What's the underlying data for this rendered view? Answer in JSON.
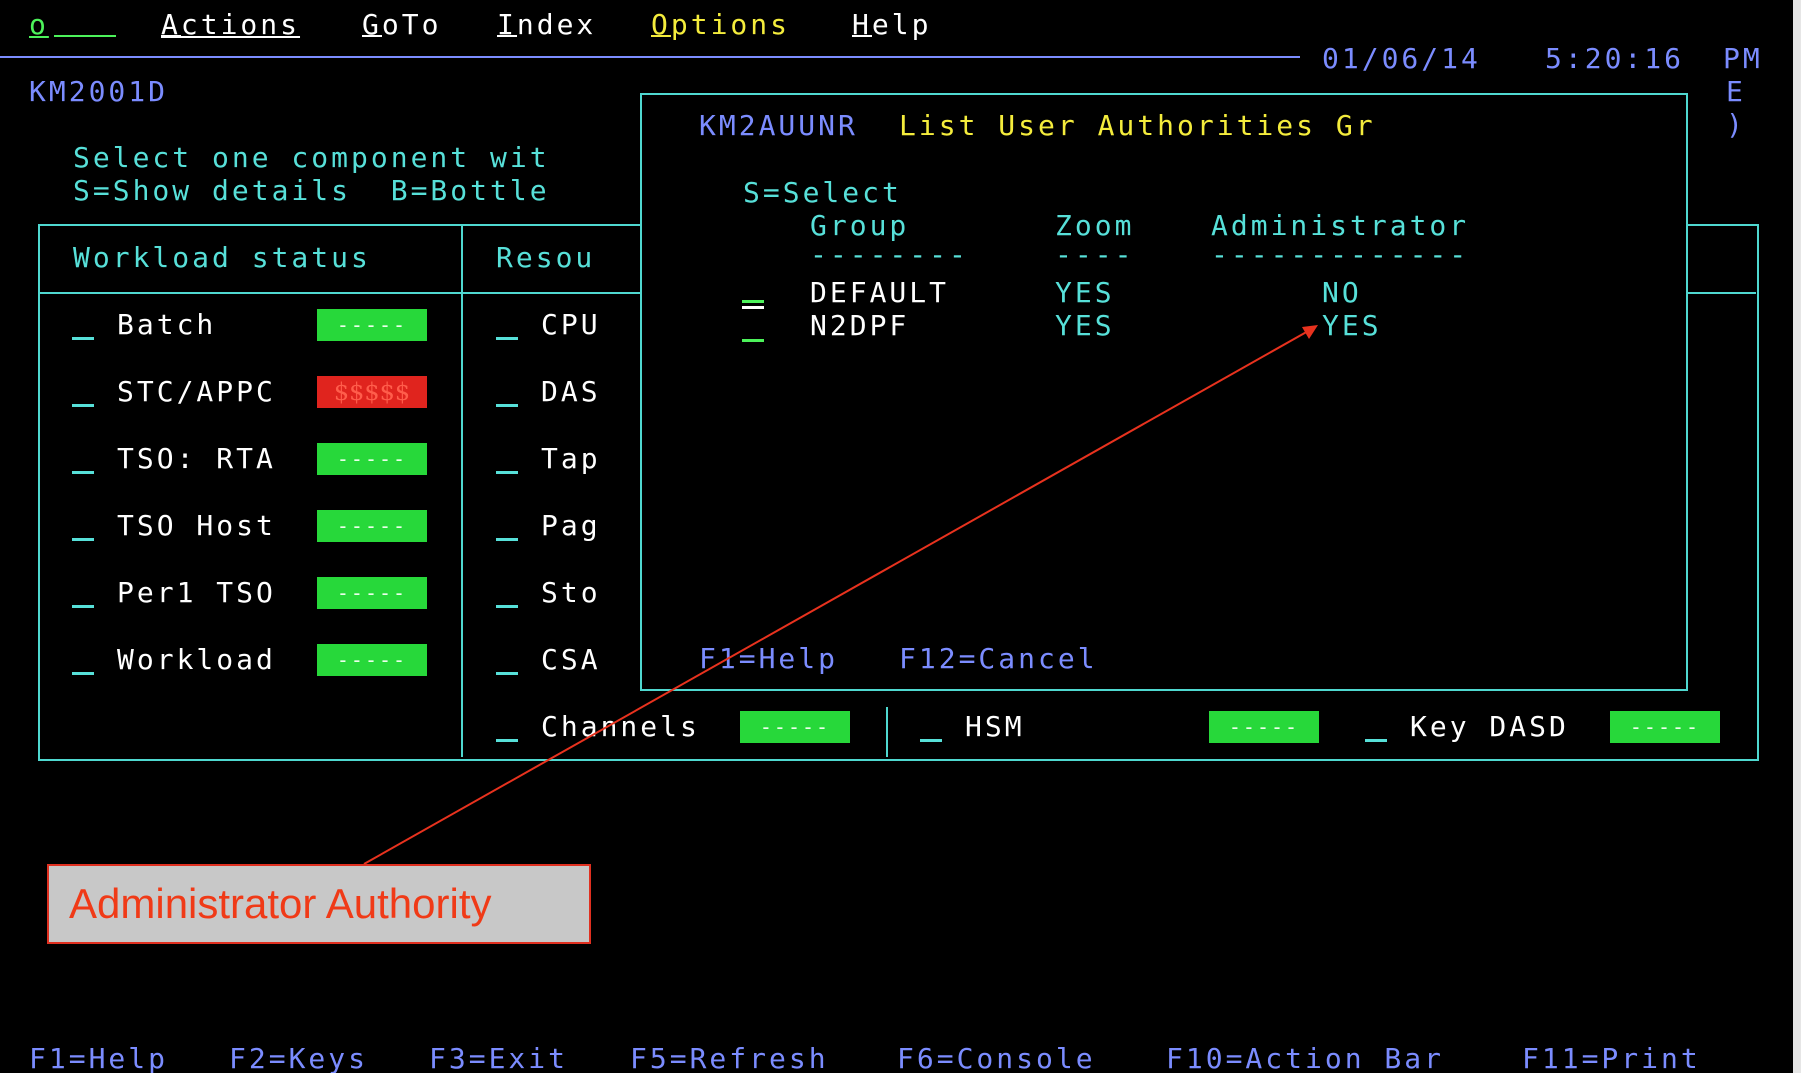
{
  "menu": {
    "input_value": "o",
    "actions": "Actions",
    "goto": "GoTo",
    "index": "Index",
    "options": "Options",
    "help": "Help"
  },
  "header": {
    "date": "01/06/14",
    "time": "5:20:16",
    "ampm": "PM",
    "panel_id": "KM2001D",
    "side_e": "E",
    "side_paren": ")"
  },
  "instructions": {
    "line1": "Select one component wit",
    "line2": "S=Show details  B=Bottle"
  },
  "workload": {
    "title": "Workload status",
    "items": [
      {
        "label": "Batch",
        "status": "-----",
        "alert": false
      },
      {
        "label": "STC/APPC",
        "status": "$$$$$",
        "alert": true
      },
      {
        "label": "TSO: RTA",
        "status": "-----",
        "alert": false
      },
      {
        "label": "TSO Host",
        "status": "-----",
        "alert": false
      },
      {
        "label": "Per1 TSO",
        "status": "-----",
        "alert": false
      },
      {
        "label": "Workload",
        "status": "-----",
        "alert": false
      }
    ]
  },
  "resources": {
    "title": "Resou",
    "items": [
      "CPU",
      "DAS",
      "Tap",
      "Pag",
      "Sto",
      "CSA"
    ]
  },
  "bottom_row": {
    "channels": {
      "label": "Channels",
      "status": "-----"
    },
    "hsm": {
      "label": "HSM",
      "status": "-----"
    },
    "key_dasd": {
      "label": "Key DASD",
      "status": "-----"
    }
  },
  "popup": {
    "panel_id": "KM2AUUNR",
    "title": "List User Authorities Gr",
    "select_hint": "S=Select",
    "columns": [
      "Group",
      "Zoom",
      "Administrator"
    ],
    "rules": [
      "--------",
      "----",
      "-------------"
    ],
    "rows": [
      {
        "group": "DEFAULT",
        "zoom": "YES",
        "admin": "NO"
      },
      {
        "group": "N2DPF",
        "zoom": "YES",
        "admin": "YES"
      }
    ],
    "fkeys": {
      "f1": "F1=Help",
      "f12": "F12=Cancel"
    }
  },
  "callout": {
    "text": "Administrator Authority",
    "color": "#f03a17"
  },
  "footer": {
    "keys": [
      "F1=Help",
      "F2=Keys",
      "F3=Exit",
      "F5=Refresh",
      "F6=Console",
      "F10=Action Bar",
      "F11=Print"
    ]
  },
  "colors": {
    "background": "#000000",
    "border": "#4fd8d0",
    "ok": "#27d83a",
    "alert": "#e0241e",
    "title_yellow": "#f4ec3c"
  }
}
